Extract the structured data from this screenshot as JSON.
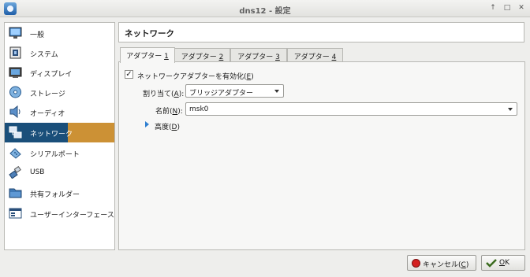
{
  "window": {
    "title": "dns12 - 設定",
    "controls": [
      "↑",
      "□",
      "✕"
    ]
  },
  "sidebar": {
    "items": [
      {
        "label": "一般",
        "icon": "monitor-icon"
      },
      {
        "label": "システム",
        "icon": "chip-icon"
      },
      {
        "label": "ディスプレイ",
        "icon": "display-icon"
      },
      {
        "label": "ストレージ",
        "icon": "storage-icon"
      },
      {
        "label": "オーディオ",
        "icon": "speaker-icon"
      },
      {
        "label": "ネットワーク",
        "icon": "network-icon",
        "selected": true
      },
      {
        "label": "シリアルポート",
        "icon": "serial-port-icon"
      },
      {
        "label": "USB",
        "icon": "usb-icon"
      },
      {
        "label": "共有フォルダー",
        "icon": "folder-icon"
      },
      {
        "label": "ユーザーインターフェース",
        "icon": "ui-icon"
      }
    ]
  },
  "main": {
    "heading": "ネットワーク",
    "tabs": [
      {
        "label": "アダプター ",
        "key": "1",
        "active": true
      },
      {
        "label": "アダプター ",
        "key": "2"
      },
      {
        "label": "アダプター ",
        "key": "3"
      },
      {
        "label": "アダプター ",
        "key": "4"
      }
    ],
    "enable_adapter": {
      "label": "ネットワークアダプターを有効化(",
      "key": "E",
      "suffix": ")",
      "checked": true,
      "mark": "✓"
    },
    "attached_to": {
      "label": "割り当て(",
      "key": "A",
      "suffix": "):",
      "value": "ブリッジアダプター"
    },
    "name": {
      "label": "名前(",
      "key": "N",
      "suffix": "):",
      "value": "msk0"
    },
    "advanced": {
      "label": "高度(",
      "key": "D",
      "suffix": ")"
    }
  },
  "buttons": {
    "cancel": {
      "label": "キャンセル(",
      "key": "C",
      "suffix": ")"
    },
    "ok": {
      "label": "OK",
      "key": "O"
    }
  },
  "colors": {
    "selection_left": "#1a4f7a",
    "selection_right": "#cc9135",
    "accent_blue": "#2f7fd0"
  }
}
